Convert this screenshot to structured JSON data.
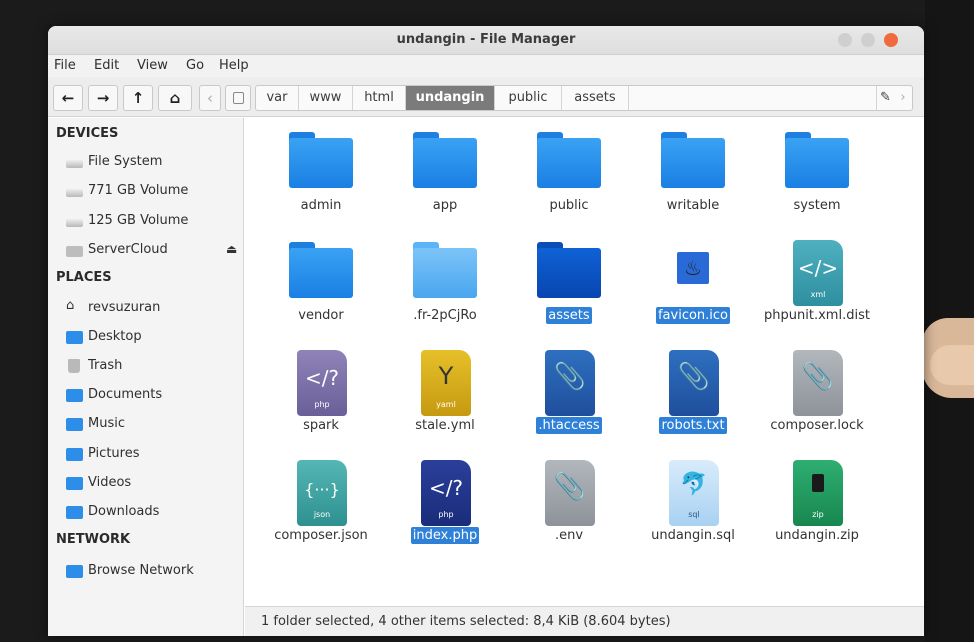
{
  "window": {
    "title": "undangin - File Manager"
  },
  "menu": [
    "File",
    "Edit",
    "View",
    "Go",
    "Help"
  ],
  "toolbar": {
    "back_icon": "←",
    "forward_icon": "→",
    "up_icon": "↑",
    "home_icon": "⌂",
    "left_arrow_icon": "‹",
    "edit_icon": "✎",
    "right_arrow_icon": "›"
  },
  "breadcrumb": [
    "var",
    "www",
    "html",
    "undangin",
    "public",
    "assets"
  ],
  "sidebar": {
    "devices_header": "DEVICES",
    "devices": [
      "File System",
      "771 GB Volume",
      "125 GB Volume",
      "ServerCloud"
    ],
    "eject_icon": "⏏",
    "places_header": "PLACES",
    "places": [
      "revsuzuran",
      "Desktop",
      "Trash",
      "Documents",
      "Music",
      "Pictures",
      "Videos",
      "Downloads"
    ],
    "network_header": "NETWORK",
    "network": [
      "Browse Network"
    ]
  },
  "files": [
    {
      "name": "admin"
    },
    {
      "name": "app"
    },
    {
      "name": "public"
    },
    {
      "name": "writable"
    },
    {
      "name": "system"
    },
    {
      "name": "vendor"
    },
    {
      "name": ".fr-2pCjRo"
    },
    {
      "name": "assets"
    },
    {
      "name": "favicon.ico"
    },
    {
      "name": "phpunit.xml.dist",
      "glyph": "</>",
      "ext": "xml"
    },
    {
      "name": "spark",
      "glyph": "</?",
      "ext": "php"
    },
    {
      "name": "stale.yml",
      "glyph": "Y",
      "ext": "yaml"
    },
    {
      "name": ".htaccess"
    },
    {
      "name": "robots.txt"
    },
    {
      "name": "composer.lock"
    },
    {
      "name": "composer.json",
      "glyph": "{···}",
      "ext": "json"
    },
    {
      "name": "index.php",
      "glyph": "</?",
      "ext": "php"
    },
    {
      "name": ".env"
    },
    {
      "name": "undangin.sql",
      "ext": "sql"
    },
    {
      "name": "undangin.zip",
      "ext": "zip"
    }
  ],
  "status": "1 folder selected, 4 other items selected: 8,4 KiB (8.604 bytes)"
}
